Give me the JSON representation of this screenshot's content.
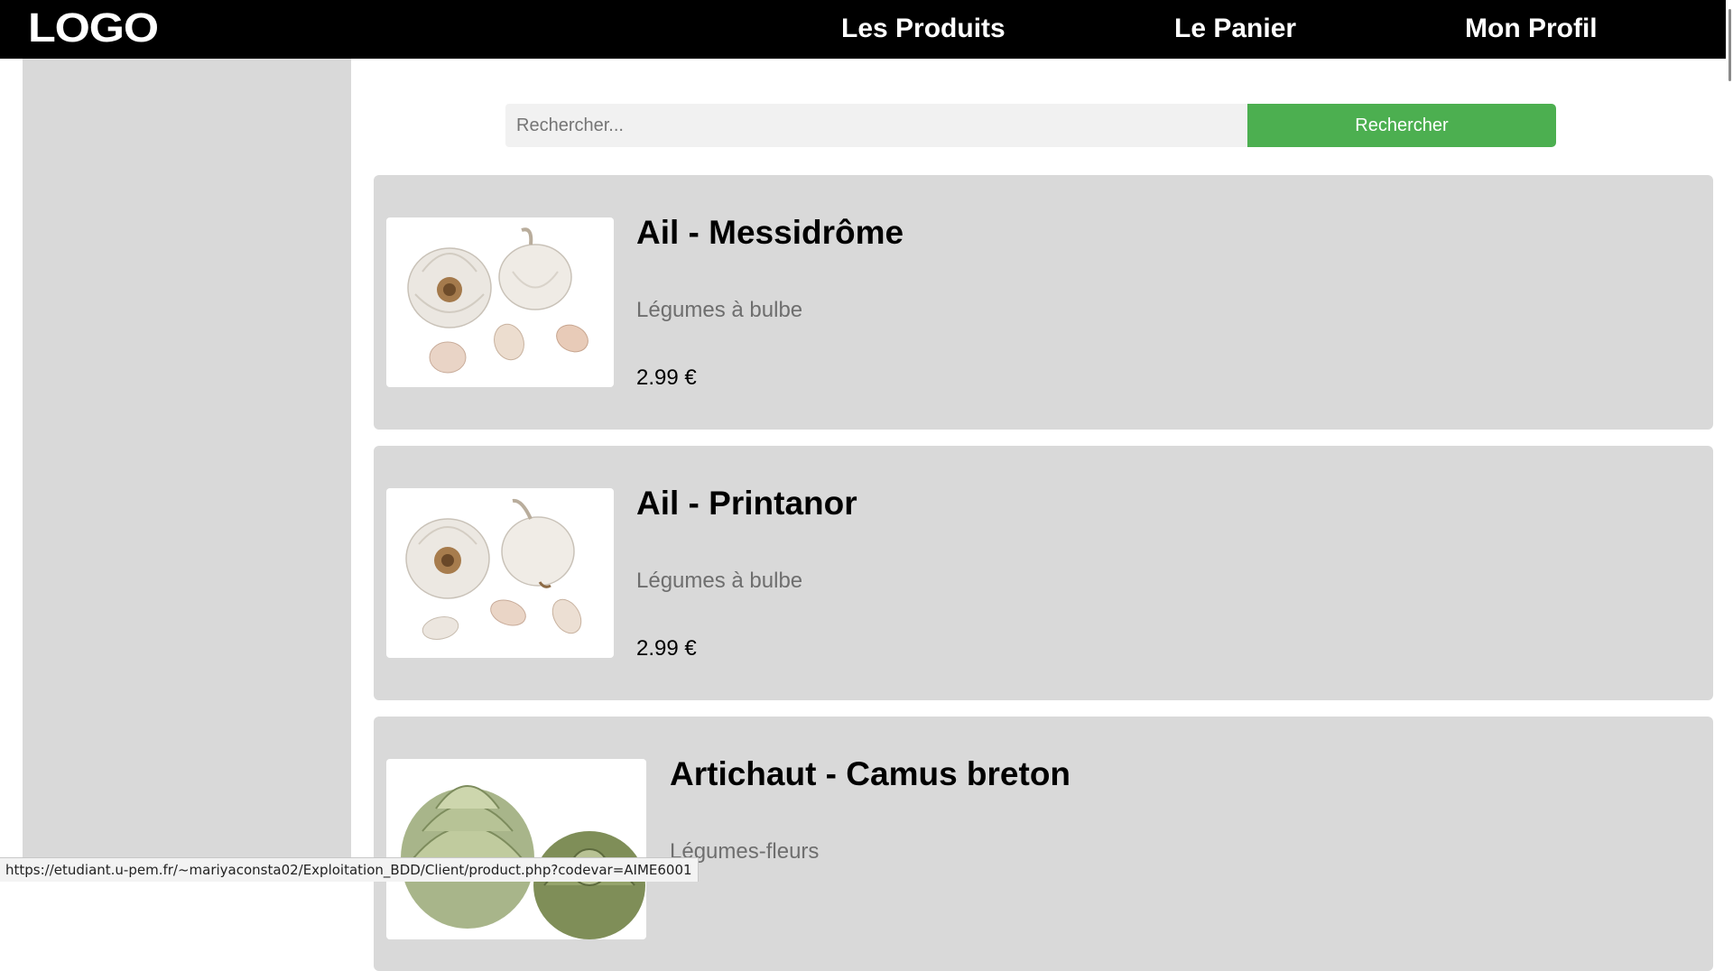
{
  "header": {
    "logo": "LOGO",
    "nav": {
      "products": "Les Produits",
      "cart": "Le Panier",
      "profile": "Mon Profil"
    }
  },
  "search": {
    "placeholder": "Rechercher...",
    "value": "",
    "button_label": "Rechercher",
    "button_color": "#4caf50"
  },
  "products": [
    {
      "name": "Ail - Messidrôme",
      "category": "Légumes à bulbe",
      "price": "2.99 €",
      "image_icon": "garlic-image"
    },
    {
      "name": "Ail - Printanor",
      "category": "Légumes à bulbe",
      "price": "2.99 €",
      "image_icon": "garlic-image"
    },
    {
      "name": "Artichaut - Camus breton",
      "category": "Légumes-fleurs",
      "price": "",
      "image_icon": "artichoke-image"
    }
  ],
  "status_bar": {
    "url": "https://etudiant.u-pem.fr/~mariyaconsta02/Exploitation_BDD/Client/product.php?codevar=AIME6001"
  },
  "colors": {
    "navbar": "#000000",
    "sidebar": "#d9d9d9",
    "card": "#d9d9d9",
    "accent": "#4caf50"
  }
}
